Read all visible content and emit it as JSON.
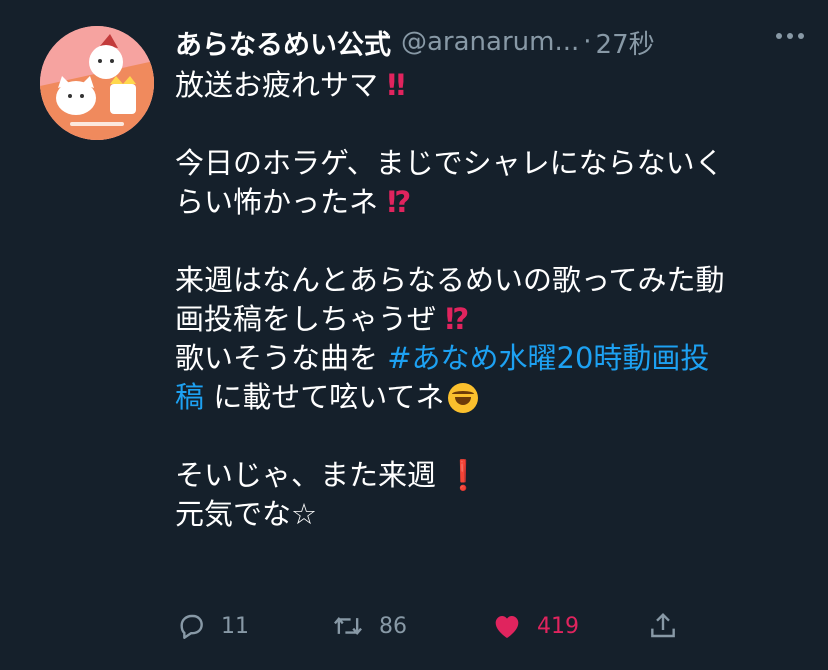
{
  "tweet": {
    "display_name": "あらなるめい公式",
    "handle": "@aranarum...",
    "separator": "·",
    "timestamp": "27秒",
    "lines": [
      "放送お疲れサマ",
      "",
      "今日のホラゲ、まじでシャレにならないく",
      "らい怖かったネ",
      "",
      "来週はなんとあらなるめいの歌ってみた動",
      "画投稿をしちゃうぜ",
      "歌いそうな曲を",
      "#あなめ水曜20時動画投",
      "稿",
      "に載せて呟いてネ",
      "",
      "そいじゃ、また来週",
      "元気でな☆"
    ],
    "marks": {
      "double_exclaim": "‼",
      "exclaim_question": "⁉",
      "exclaim": "❗"
    }
  },
  "actions": {
    "reply_count": "11",
    "retweet_count": "86",
    "like_count": "419"
  },
  "colors": {
    "background": "#15202b",
    "text": "#ffffff",
    "muted": "#8899a6",
    "link": "#1da1f2",
    "like": "#e0245e"
  },
  "icons": [
    "more-icon",
    "reply-icon",
    "retweet-icon",
    "heart-icon",
    "share-icon",
    "laughing-emoji-icon"
  ]
}
